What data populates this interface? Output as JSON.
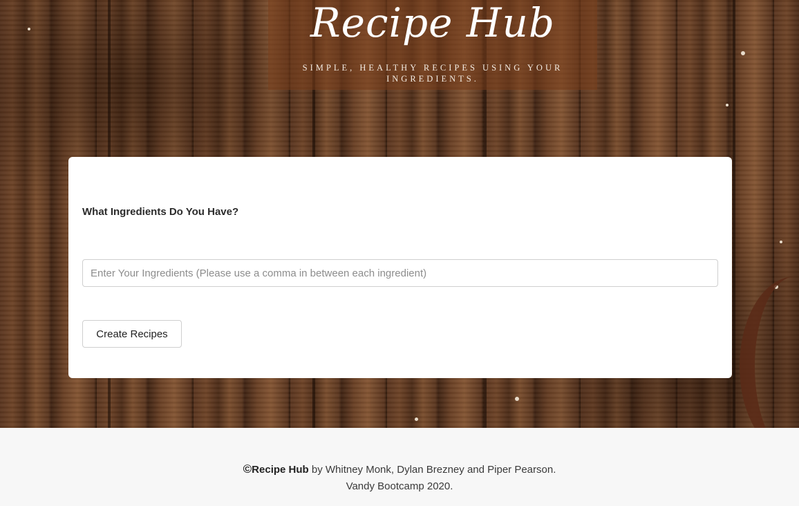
{
  "header": {
    "title": "Recipe Hub",
    "subtitle": "SIMPLE, HEALTHY RECIPES USING YOUR INGREDIENTS."
  },
  "form": {
    "label": "What Ingredients Do You Have?",
    "input_value": "",
    "input_placeholder": "Enter Your Ingredients (Please use a comma in between each ingredient)",
    "button_label": "Create Recipes"
  },
  "footer": {
    "copyright_symbol": "©",
    "brand": "Recipe Hub",
    "credits": " by Whitney Monk, Dylan Brezney and Piper Pearson.",
    "line2": "Vandy Bootcamp 2020."
  },
  "icons": {
    "copyright": "copyright-icon"
  },
  "colors": {
    "card_background": "#ffffff",
    "footer_background": "#f7f7f7",
    "banner_overlay": "#783e1c"
  }
}
